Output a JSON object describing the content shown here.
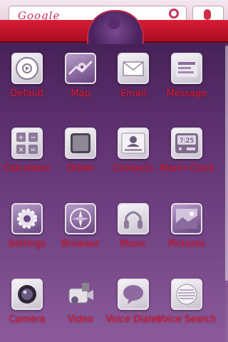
{
  "search": {
    "logo_text": "Google"
  },
  "apps": [
    {
      "id": "default",
      "label": "Default",
      "icon": "music-player-icon"
    },
    {
      "id": "map",
      "label": "Map",
      "icon": "map-icon"
    },
    {
      "id": "email",
      "label": "Email",
      "icon": "envelope-icon"
    },
    {
      "id": "message",
      "label": "Message",
      "icon": "message-icon"
    },
    {
      "id": "calculator",
      "label": "Calculator",
      "icon": "calculator-icon"
    },
    {
      "id": "dialer",
      "label": "Dialer",
      "icon": "phone-screen-icon"
    },
    {
      "id": "contacts",
      "label": "Contacts",
      "icon": "contact-card-icon"
    },
    {
      "id": "alarm",
      "label": "Alarm Clock",
      "icon": "alarm-clock-icon",
      "clock_time": "7:25"
    },
    {
      "id": "settings",
      "label": "Settings",
      "icon": "gear-icon"
    },
    {
      "id": "browser",
      "label": "Browser",
      "icon": "compass-icon"
    },
    {
      "id": "music",
      "label": "Music",
      "icon": "headphones-icon"
    },
    {
      "id": "pictures",
      "label": "Pictures",
      "icon": "picture-icon"
    },
    {
      "id": "camera",
      "label": "Camera",
      "icon": "camera-lens-icon"
    },
    {
      "id": "video",
      "label": "Video",
      "icon": "video-camera-icon"
    },
    {
      "id": "voicedial",
      "label": "Voice Dialer",
      "icon": "speech-bubble-icon"
    },
    {
      "id": "voicesearch",
      "label": "Voice Search",
      "icon": "speaker-grille-icon"
    }
  ],
  "colors": {
    "label": "#e0182b",
    "accent_red": "#d71d34",
    "background": "#5c2f6e"
  }
}
